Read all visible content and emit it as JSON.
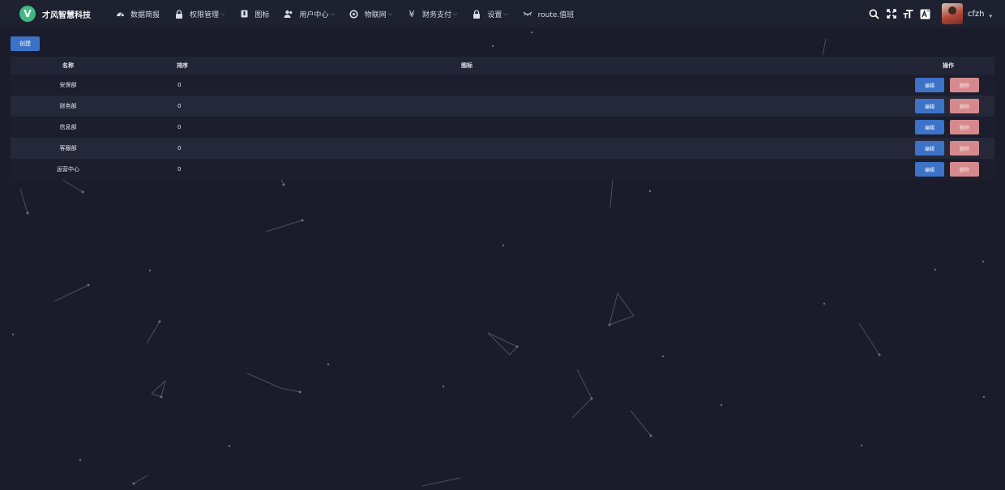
{
  "app": {
    "logo_letter": "V",
    "name": "才风智慧科技",
    "brand_color": "#42b883"
  },
  "nav": {
    "items": [
      {
        "label": "数据简报",
        "icon": "dashboard-icon",
        "caret": false
      },
      {
        "label": "权限管理",
        "icon": "lock-icon",
        "caret": true
      },
      {
        "label": "图标",
        "icon": "bookmark-icon",
        "caret": false
      },
      {
        "label": "用户中心",
        "icon": "users-icon",
        "caret": true
      },
      {
        "label": "物联网",
        "icon": "target-icon",
        "caret": true
      },
      {
        "label": "财务支付",
        "icon": "yen-icon",
        "caret": true
      },
      {
        "label": "设置",
        "icon": "lock-icon",
        "caret": true
      },
      {
        "label": "route.值班",
        "icon": "eye-closed-icon",
        "caret": false
      }
    ],
    "caret_glyph": "⌵"
  },
  "toolbar": {
    "icons": [
      "search-icon",
      "fullscreen-icon",
      "font-size-icon",
      "translate-icon"
    ]
  },
  "user": {
    "name": "cfzh",
    "caret": "▾"
  },
  "actions": {
    "create_label": "创建",
    "primary_color": "#3d72c9",
    "danger_color": "#d6898c"
  },
  "table": {
    "headers": {
      "name": "名称",
      "sort": "排序",
      "icon": "图标",
      "ops": "操作"
    },
    "edit_label": "编辑",
    "delete_label": "删除",
    "rows": [
      {
        "name": "安保部",
        "sort": "0",
        "icon": ""
      },
      {
        "name": "财务部",
        "sort": "0",
        "icon": ""
      },
      {
        "name": "信息部",
        "sort": "0",
        "icon": ""
      },
      {
        "name": "客服部",
        "sort": "0",
        "icon": ""
      },
      {
        "name": "运营中心",
        "sort": "0",
        "icon": ""
      }
    ]
  }
}
